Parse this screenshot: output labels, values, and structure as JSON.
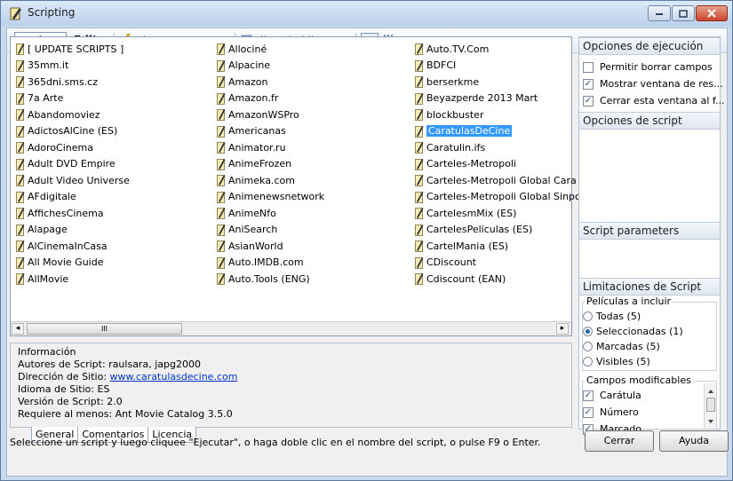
{
  "window": {
    "title": "Scripting"
  },
  "toolbar": {
    "scripts_tab": "Scripts",
    "editor_tab": "Editor",
    "run_label": "Ejecutar",
    "stop_label": "Parar",
    "filter_label": "Filtro de idioma",
    "filter_arrow": "▾"
  },
  "scripts": {
    "col1": [
      "[ UPDATE SCRIPTS ]",
      "35mm.it",
      "365dni.sms.cz",
      "7a Arte",
      "Abandomoviez",
      "AdictosAlCine (ES)",
      "AdoroCinema",
      "Adult DVD Empire",
      "Adult Video Universe",
      "AFdigitale",
      "AffichesCinema",
      "Alapage",
      "AlCinemaInCasa",
      "All Movie Guide",
      "AllMovie"
    ],
    "col2": [
      "Allociné",
      "Alpacine",
      "Amazon",
      "Amazon.fr",
      "AmazonWSPro",
      "Americanas",
      "Animator.ru",
      "AnimeFrozen",
      "Animeka.com",
      "Animenewsnetwork",
      "AnimeNfo",
      "AniSearch",
      "AsianWorld",
      "Auto.IMDB.com",
      "Auto.Tools (ENG)"
    ],
    "col3": [
      "Auto.TV.Com",
      "BDFCI",
      "berserkme",
      "Beyazperde 2013 Mart",
      "blockbuster",
      "CaratulasDeCine",
      "Caratulin.ifs",
      "Carteles-Metropoli",
      "Carteles-Metropoli Global Cara",
      "Carteles-Metropoli Global Sinpc",
      "CartelesmMix (ES)",
      "CartelesPeliculas (ES)",
      "CartelMania (ES)",
      "CDiscount",
      "Cdiscount (EAN)"
    ],
    "selected": "CaratulasDeCine"
  },
  "scrollbar": {
    "left_arrow": "◂",
    "right_arrow": "▸",
    "grip": "III"
  },
  "info": {
    "heading": "Información",
    "authors": "Autores de Script: raulsara, japg2000",
    "site_prefix": "Dirección de Sitio: ",
    "site_url": "www.caratulasdecine.com",
    "language": "Idioma de Sitio: ES",
    "version": "Versión de Script: 2.0",
    "requires": "Requiere al menos: Ant Movie Catalog 3.5.0"
  },
  "info_tabs": [
    "General",
    "Comentarios",
    "Licencia"
  ],
  "right_panel": {
    "exec_options_title": "Opciones de ejecución",
    "exec_options": [
      {
        "label": "Permitir borrar campos",
        "checked": false
      },
      {
        "label": "Mostrar ventana de res...",
        "checked": true
      },
      {
        "label": "Cerrar esta ventana al f...",
        "checked": true
      }
    ],
    "script_options_title": "Opciones de script",
    "script_params_title": "Script parameters",
    "limits_title": "Limitaciones de Script",
    "movies_group_label": "Películas a incluir",
    "movies_options": [
      {
        "label": "Todas (5)",
        "selected": false
      },
      {
        "label": "Seleccionadas (1)",
        "selected": true
      },
      {
        "label": "Marcadas (5)",
        "selected": false
      },
      {
        "label": "Visibles (5)",
        "selected": false
      }
    ],
    "fields_group_label": "Campos modificables",
    "fields": [
      {
        "label": "Carátula",
        "checked": true
      },
      {
        "label": "Número",
        "checked": true
      },
      {
        "label": "Marcado",
        "checked": true
      }
    ],
    "check_mark": "✓"
  },
  "status_text": "Seleccione un script y luego cliquee \"Ejecutar\", o haga doble clic en el nombre del script, o pulse F9 o Enter.",
  "buttons": {
    "close": "Cerrar",
    "help": "Ayuda"
  }
}
